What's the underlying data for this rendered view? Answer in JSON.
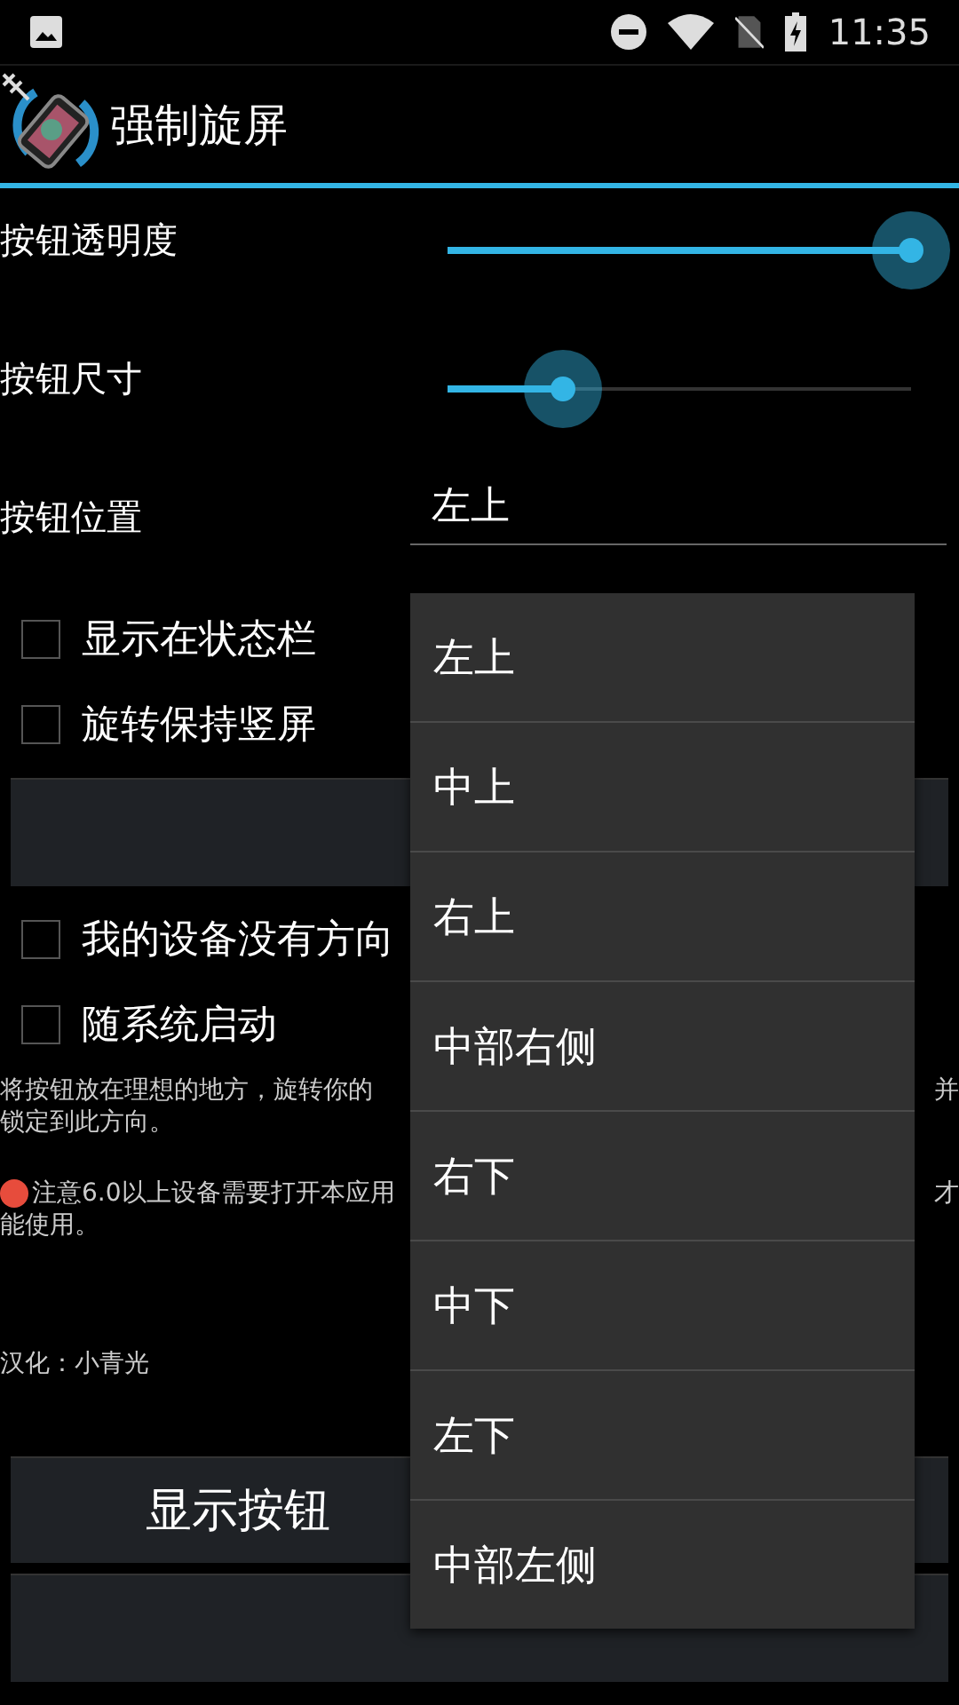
{
  "status_bar": {
    "time": "11:35"
  },
  "app_bar": {
    "title": "强制旋屏"
  },
  "sliders": [
    {
      "label": "按钮透明度",
      "level": 1.0
    },
    {
      "label": "按钮尺寸",
      "level": 0.25
    }
  ],
  "position": {
    "label": "按钮位置",
    "value": "左上"
  },
  "checkboxes_top": [
    {
      "label": "显示在状态栏",
      "checked": false
    },
    {
      "label": "旋转保持竖屏",
      "checked": false
    }
  ],
  "checkboxes_bottom": [
    {
      "label": "我的设备没有方向",
      "checked": false
    },
    {
      "label": "随系统启动",
      "checked": false
    }
  ],
  "description": {
    "line_1_left": "将按钮放在理想的地方，旋转你的",
    "line_1_right": "并",
    "line_2": "锁定到此方向。"
  },
  "notice": {
    "line_1_left": "注意6.0以上设备需要打开本应用",
    "line_1_right": "才",
    "line_2": "能使用。"
  },
  "credit": "汉化：小青光",
  "buttons": [
    {
      "label": "显示按钮"
    }
  ],
  "dropdown_menu": [
    {
      "label": "左上"
    },
    {
      "label": "中上"
    },
    {
      "label": "右上"
    },
    {
      "label": "中部右侧"
    },
    {
      "label": "右下"
    },
    {
      "label": "中下"
    },
    {
      "label": "左下"
    },
    {
      "label": "中部左侧"
    }
  ]
}
